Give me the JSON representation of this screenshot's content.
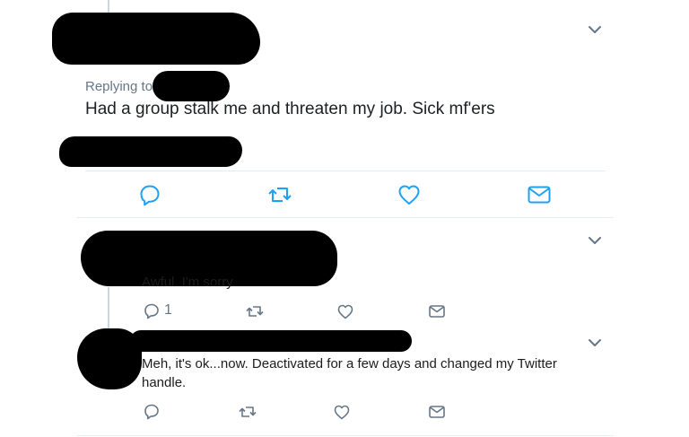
{
  "tweet_main": {
    "replying_to_label": "Replying to",
    "text": "Had a group stalk me and threaten my job.  Sick mf'ers"
  },
  "reply1": {
    "text": "Awful. I'm sorry.",
    "reply_count": "1"
  },
  "reply2": {
    "text": "Meh, it's ok...now.  Deactivated for a few days and changed my Twitter handle."
  },
  "icons": {
    "reply": "reply-icon",
    "retweet": "retweet-icon",
    "like": "heart-icon",
    "dm": "envelope-icon",
    "more": "chevron-down-icon"
  },
  "colors": {
    "icon_blue": "#1da1f2",
    "icon_gray": "#657786",
    "divider": "#e6ecf0",
    "replying_gray": "#657786"
  }
}
